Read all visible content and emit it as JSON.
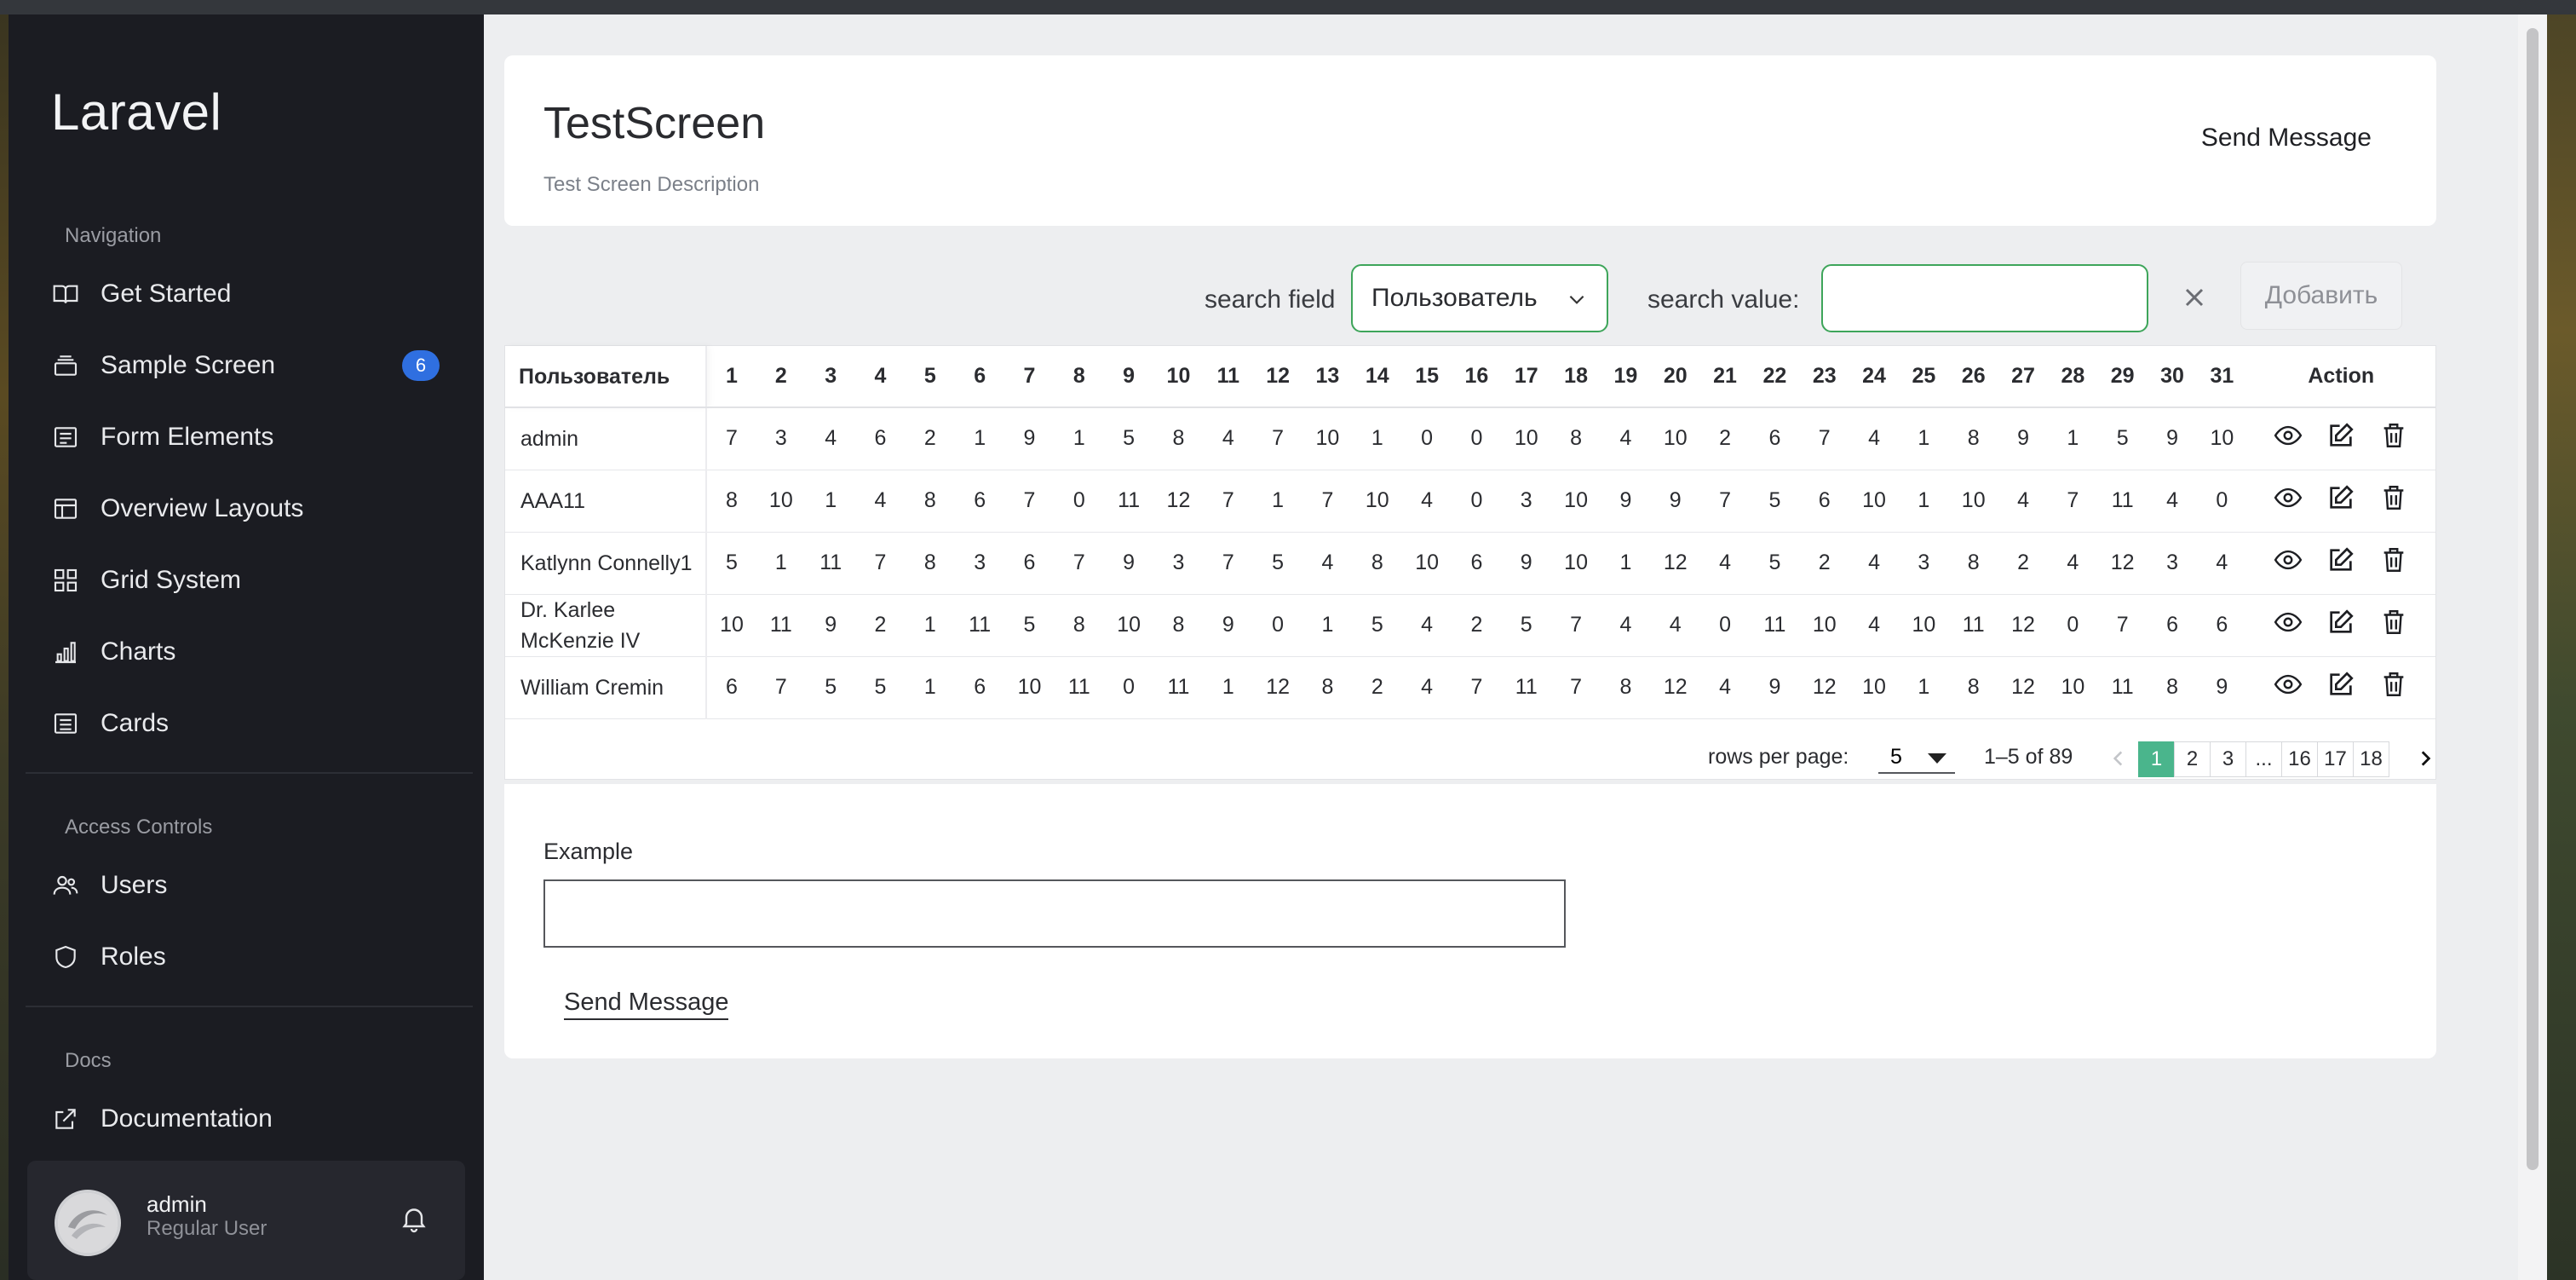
{
  "sidebar": {
    "brand": "Laravel",
    "sections": {
      "navigation": "Navigation",
      "access": "Access Controls",
      "docs": "Docs"
    },
    "nav_items": [
      {
        "label": "Get Started",
        "icon": "book-open-icon"
      },
      {
        "label": "Sample Screen",
        "icon": "stack-icon",
        "badge": "6"
      },
      {
        "label": "Form Elements",
        "icon": "form-list-icon"
      },
      {
        "label": "Overview Layouts",
        "icon": "layout-icon"
      },
      {
        "label": "Grid System",
        "icon": "grid-icon"
      },
      {
        "label": "Charts",
        "icon": "bar-chart-icon"
      },
      {
        "label": "Cards",
        "icon": "card-list-icon"
      }
    ],
    "access_items": [
      {
        "label": "Users",
        "icon": "users-icon"
      },
      {
        "label": "Roles",
        "icon": "shield-icon"
      }
    ],
    "docs_items": [
      {
        "label": "Documentation",
        "icon": "external-link-icon"
      }
    ],
    "user": {
      "name": "admin",
      "role": "Regular User"
    }
  },
  "header": {
    "title": "TestScreen",
    "description": "Test Screen Description",
    "send_button": "Send Message"
  },
  "filters": {
    "search_field_label": "search field",
    "search_field_value": "Пользователь",
    "search_value_label": "search value:",
    "search_value": "",
    "add_button": "Добавить"
  },
  "table": {
    "first_column": "Пользователь",
    "day_columns": [
      "1",
      "2",
      "3",
      "4",
      "5",
      "6",
      "7",
      "8",
      "9",
      "10",
      "11",
      "12",
      "13",
      "14",
      "15",
      "16",
      "17",
      "18",
      "19",
      "20",
      "21",
      "22",
      "23",
      "24",
      "25",
      "26",
      "27",
      "28",
      "29",
      "30",
      "31"
    ],
    "action_column": "Action",
    "rows": [
      {
        "user": "admin",
        "values": [
          7,
          3,
          4,
          6,
          2,
          1,
          9,
          1,
          5,
          8,
          4,
          7,
          10,
          1,
          0,
          0,
          10,
          8,
          4,
          10,
          2,
          6,
          7,
          4,
          1,
          8,
          9,
          1,
          5,
          9,
          10
        ]
      },
      {
        "user": "AAA11",
        "values": [
          8,
          10,
          1,
          4,
          8,
          6,
          7,
          0,
          11,
          12,
          7,
          1,
          7,
          10,
          4,
          0,
          3,
          10,
          9,
          9,
          7,
          5,
          6,
          10,
          1,
          10,
          4,
          7,
          11,
          4,
          0
        ]
      },
      {
        "user": "Katlynn Connelly1",
        "values": [
          5,
          1,
          11,
          7,
          8,
          3,
          6,
          7,
          9,
          3,
          7,
          5,
          4,
          8,
          10,
          6,
          9,
          10,
          1,
          12,
          4,
          5,
          2,
          4,
          3,
          8,
          2,
          4,
          12,
          3,
          4
        ]
      },
      {
        "user": "Dr. Karlee McKenzie IV",
        "values": [
          10,
          11,
          9,
          2,
          1,
          11,
          5,
          8,
          10,
          8,
          9,
          0,
          1,
          5,
          4,
          2,
          5,
          7,
          4,
          4,
          0,
          11,
          10,
          4,
          10,
          11,
          12,
          0,
          7,
          6,
          6
        ]
      },
      {
        "user": "William Cremin",
        "values": [
          6,
          7,
          5,
          5,
          1,
          6,
          10,
          11,
          0,
          11,
          1,
          12,
          8,
          2,
          4,
          7,
          11,
          7,
          8,
          12,
          4,
          9,
          12,
          10,
          1,
          8,
          12,
          10,
          11,
          8,
          9
        ]
      }
    ]
  },
  "pagination": {
    "rows_per_page_label": "rows per page:",
    "rows_per_page": "5",
    "range": "1–5 of 89",
    "pages": [
      "1",
      "2",
      "3",
      "...",
      "16",
      "17",
      "18"
    ],
    "current_page": "1"
  },
  "form": {
    "label": "Example",
    "value": "",
    "send_button": "Send Message"
  }
}
